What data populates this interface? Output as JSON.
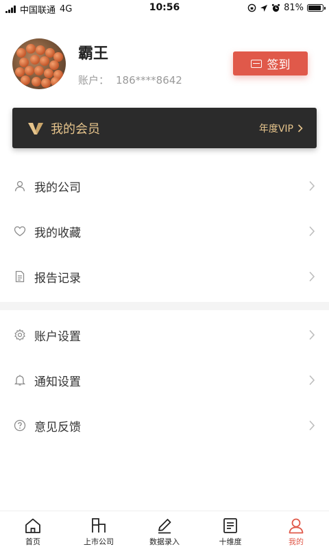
{
  "status_bar": {
    "carrier": "中国联通",
    "network": "4G",
    "time": "10:56",
    "battery": "81%",
    "battery_level": 0.81
  },
  "profile": {
    "username": "霸王",
    "account_label": "账户：",
    "account_number": "186****8642",
    "checkin_label": "签到"
  },
  "vip": {
    "title": "我的会员",
    "level": "年度VIP",
    "accent_color": "#e6c48c"
  },
  "menu": {
    "group1": [
      {
        "label": "我的公司",
        "icon": "user-icon"
      },
      {
        "label": "我的收藏",
        "icon": "heart-icon"
      },
      {
        "label": "报告记录",
        "icon": "document-icon"
      }
    ],
    "group2": [
      {
        "label": "账户设置",
        "icon": "gear-icon"
      },
      {
        "label": "通知设置",
        "icon": "bell-icon"
      },
      {
        "label": "意见反馈",
        "icon": "question-icon"
      }
    ]
  },
  "bottom_nav": [
    {
      "label": "首页",
      "icon": "home-icon"
    },
    {
      "label": "上市公司",
      "icon": "listed-company-icon"
    },
    {
      "label": "数据录入",
      "icon": "pencil-icon"
    },
    {
      "label": "十维度",
      "icon": "notepad-icon"
    },
    {
      "label": "我的",
      "icon": "profile-icon",
      "active": true
    }
  ],
  "colors": {
    "accent": "#e0594a",
    "vip_background": "#2b2b2b"
  }
}
